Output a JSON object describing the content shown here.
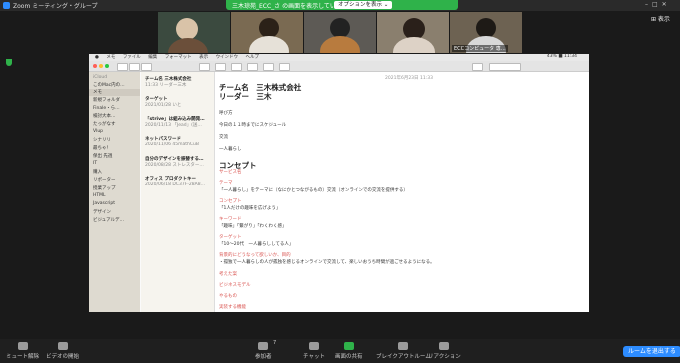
{
  "window": {
    "title": "Zoom ミーティング・グループ"
  },
  "banner": {
    "text": "三木琼苑_ECC_さ の画面を表示しています",
    "options_label": "オプションを表示 ⌄"
  },
  "view_label": "⊞ 表示",
  "participants": [
    {
      "name": ""
    },
    {
      "name": ""
    },
    {
      "name": ""
    },
    {
      "name": ""
    },
    {
      "name": "ECCコンピュータ 専…"
    }
  ],
  "notes_app": {
    "menubar": [
      "メモ",
      "ファイル",
      "編集",
      "フォーマット",
      "表示",
      "ウインドウ",
      "ヘルプ"
    ],
    "status_right": "43% ■  11:34",
    "sidebar": [
      {
        "label": "iCloud"
      },
      {
        "label": "このMac内の…"
      },
      {
        "label": "メモ"
      },
      {
        "label": "新規フォルダ"
      },
      {
        "label": "Finale・ら…"
      },
      {
        "label": "検討大本…"
      },
      {
        "label": "たっがなす"
      },
      {
        "label": "Vlup"
      },
      {
        "label": "シナリリ"
      },
      {
        "label": "最ちゃ！"
      },
      {
        "label": "保出 先週"
      },
      {
        "label": "IT"
      },
      {
        "label": "購入"
      },
      {
        "label": "リポーター"
      },
      {
        "label": "授業アップ"
      },
      {
        "label": "HTML"
      },
      {
        "label": "Javascript"
      },
      {
        "label": "デザイン"
      },
      {
        "label": "ビジュアルデ…"
      }
    ],
    "notes": [
      {
        "title": "チーム名 三木株式会社",
        "date": "11:33  リーダー三木"
      },
      {
        "title": "ターゲット",
        "date": "2021/01/28  いと"
      },
      {
        "title": "「strive」は組み込み開発…",
        "date": "2020/11/13  「Jead」(送…"
      },
      {
        "title": "ネットパスワード",
        "date": "2020/11/06  45mathCuB"
      },
      {
        "title": "自分のデザインを振替する…",
        "date": "2020/08/28  ストレスター…"
      },
      {
        "title": "オフィス プロダクトキー",
        "date": "2020/06/18  DC37F-28A8…"
      }
    ],
    "editor": {
      "timestamp": "2021年6月23日 11:33",
      "heading1": "チーム名　三木株式会社",
      "heading2": "リーダー　三木",
      "lines": [
        "呼び方",
        "今日の１１時までにスケジュール",
        "交流",
        "一人暮らし"
      ],
      "concept_heading": "コンセプト",
      "section_service": "サービス名",
      "section_theme": "テーマ",
      "theme_text": "「一人暮らし」をテーマに（なにかとつながるもの）交流（オンラインでの交流を提供する）",
      "section_concept": "コンセプト",
      "concept_text": "「1人だけの趣味を広げよう」",
      "section_keyword": "キーワード",
      "keyword_text": "「趣味」「繋がり」「わくわく感」",
      "section_target": "ターゲット",
      "target_text": "「10～20代　一人暮らししてる人」",
      "section_bg": "背景的にどうなって欲しいか、目的",
      "bg_text": "・孤独で一人暮らしの人が孤独を感じるオンラインで交流して、楽しいおうち時間が過ごせるようになる。",
      "section_app": "考えた案",
      "section_biz": "ビジネスモデル",
      "section_misc": "やるもの",
      "section_plan": "実装する機能"
    }
  },
  "bottombar": {
    "mute": "ミュート解除",
    "video": "ビデオの開始",
    "participants": "参加者",
    "participants_count": "7",
    "chat": "チャット",
    "share": "画面の共有",
    "breakout": "ブレイクアウトルーム",
    "reaction": "リアクション",
    "leave": "ルームを退出する"
  }
}
